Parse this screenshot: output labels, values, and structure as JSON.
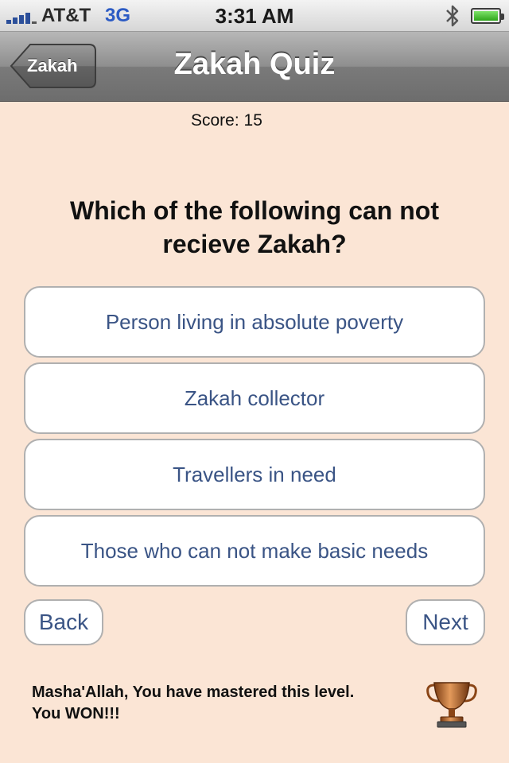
{
  "status_bar": {
    "carrier": "AT&T",
    "network": "3G",
    "time": "3:31 AM",
    "icons": [
      "signal-icon",
      "bluetooth-icon",
      "battery-icon"
    ]
  },
  "nav": {
    "back_label": "Zakah",
    "title": "Zakah Quiz"
  },
  "quiz": {
    "score": "Score: 15",
    "question": "Which of the following can not recieve Zakah?",
    "answers": [
      "Person living in absolute poverty",
      "Zakah collector",
      "Travellers in need",
      "Those who can not make basic needs"
    ],
    "back_label": "Back",
    "next_label": "Next"
  },
  "result": {
    "line1": "Masha'Allah, You have mastered this level.",
    "line2": "You WON!!!",
    "icon": "trophy-icon"
  },
  "colors": {
    "background": "#fbe5d5",
    "button_text": "#3a5485",
    "nav_bar": "#8e8e8e"
  }
}
